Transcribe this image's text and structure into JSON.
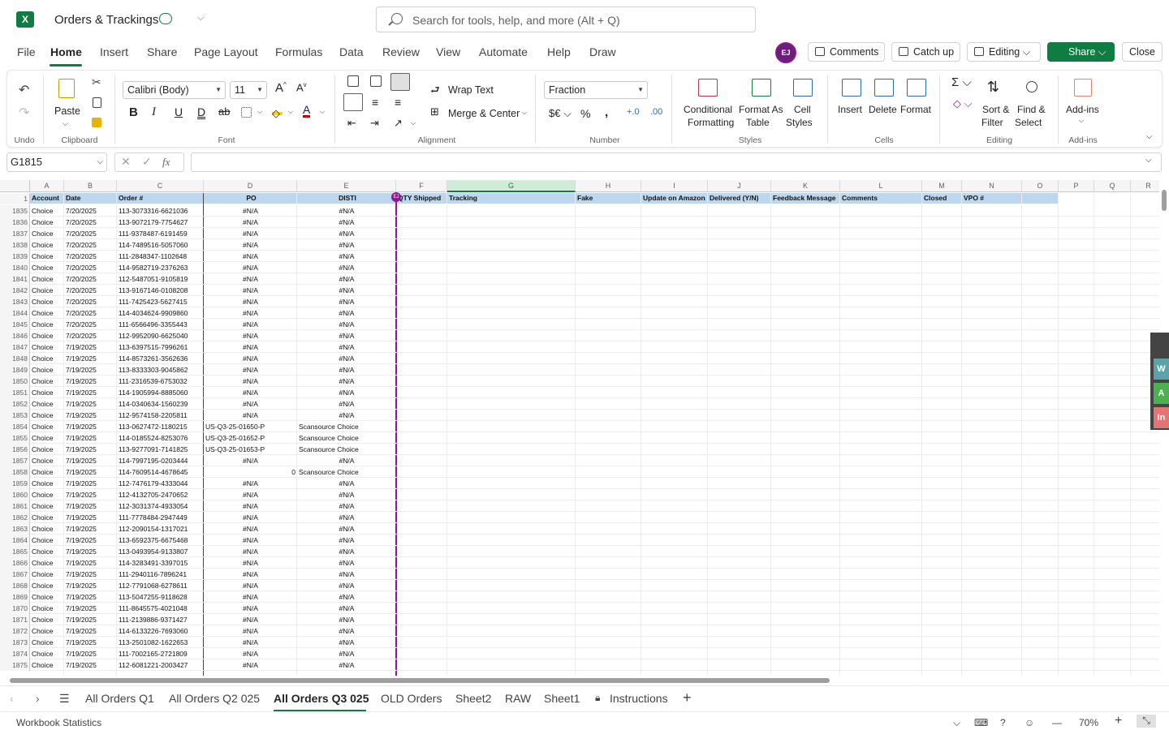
{
  "app": {
    "title": "Orders & Trackings",
    "search_placeholder": "Search for tools, help, and more (Alt + Q)",
    "avatar": "EJ"
  },
  "menu": [
    "File",
    "Home",
    "Insert",
    "Share",
    "Page Layout",
    "Formulas",
    "Data",
    "Review",
    "View",
    "Automate",
    "Help",
    "Draw"
  ],
  "top_buttons": {
    "comments": "Comments",
    "catchup": "Catch up",
    "editing": "Editing",
    "share": "Share",
    "close": "Close"
  },
  "ribbon": {
    "undo_label": "Undo",
    "paste": "Paste",
    "clipboard": "Clipboard",
    "font_name": "Calibri (Body)",
    "font_size": "11",
    "font": "Font",
    "wrap": "Wrap Text",
    "merge": "Merge & Center",
    "alignment": "Alignment",
    "number_format": "Fraction",
    "number": "Number",
    "cond1": "Conditional",
    "cond2": "Formatting",
    "fmt1": "Format As",
    "fmt2": "Table",
    "cs1": "Cell",
    "cs2": "Styles",
    "styles": "Styles",
    "insert": "Insert",
    "delete": "Delete",
    "format": "Format",
    "cells": "Cells",
    "sort1": "Sort &",
    "sort2": "Filter",
    "find1": "Find &",
    "find2": "Select",
    "editing": "Editing",
    "addins": "Add-ins",
    "addins_group": "Add-ins"
  },
  "formula": {
    "namebox": "G1815",
    "fx": "fx",
    "value": ""
  },
  "grid": {
    "columns": [
      "A",
      "B",
      "C",
      "D",
      "E",
      "F",
      "G",
      "H",
      "I",
      "J",
      "K",
      "L",
      "M",
      "N",
      "O",
      "P",
      "Q",
      "R"
    ],
    "headers": [
      "Account",
      "Date",
      "Order #",
      "PO",
      "DISTI",
      "QTY Shipped",
      "Tracking",
      "Fake",
      "Update on Amazon",
      "Delivered (Y/N)",
      "Feedback Message",
      "Comments",
      "Closed",
      "VPO #"
    ],
    "rows": [
      [
        "1835",
        "Choice",
        "7/20/2025",
        "113-3073316-6621036",
        "#N/A",
        "#N/A"
      ],
      [
        "1836",
        "Choice",
        "7/20/2025",
        "113-9072179-7754627",
        "#N/A",
        "#N/A"
      ],
      [
        "1837",
        "Choice",
        "7/20/2025",
        "111-9378487-6191459",
        "#N/A",
        "#N/A"
      ],
      [
        "1838",
        "Choice",
        "7/20/2025",
        "114-7489516-5057060",
        "#N/A",
        "#N/A"
      ],
      [
        "1839",
        "Choice",
        "7/20/2025",
        "111-2848347-1102648",
        "#N/A",
        "#N/A"
      ],
      [
        "1840",
        "Choice",
        "7/20/2025",
        "114-9582719-2376263",
        "#N/A",
        "#N/A"
      ],
      [
        "1841",
        "Choice",
        "7/20/2025",
        "112-5487051-9105819",
        "#N/A",
        "#N/A"
      ],
      [
        "1842",
        "Choice",
        "7/20/2025",
        "113-9167146-0108208",
        "#N/A",
        "#N/A"
      ],
      [
        "1843",
        "Choice",
        "7/20/2025",
        "111-7425423-5627415",
        "#N/A",
        "#N/A"
      ],
      [
        "1844",
        "Choice",
        "7/20/2025",
        "114-4034624-9909860",
        "#N/A",
        "#N/A"
      ],
      [
        "1845",
        "Choice",
        "7/20/2025",
        "111-6566496-3355443",
        "#N/A",
        "#N/A"
      ],
      [
        "1846",
        "Choice",
        "7/20/2025",
        "112-9952090-6625040",
        "#N/A",
        "#N/A"
      ],
      [
        "1847",
        "Choice",
        "7/19/2025",
        "113-6397515-7996261",
        "#N/A",
        "#N/A"
      ],
      [
        "1848",
        "Choice",
        "7/19/2025",
        "114-8573261-3562636",
        "#N/A",
        "#N/A"
      ],
      [
        "1849",
        "Choice",
        "7/19/2025",
        "113-8333303-9045862",
        "#N/A",
        "#N/A"
      ],
      [
        "1850",
        "Choice",
        "7/19/2025",
        "111-2316539-6753032",
        "#N/A",
        "#N/A"
      ],
      [
        "1851",
        "Choice",
        "7/19/2025",
        "114-1905994-8885060",
        "#N/A",
        "#N/A"
      ],
      [
        "1852",
        "Choice",
        "7/19/2025",
        "114-0340634-1560239",
        "#N/A",
        "#N/A"
      ],
      [
        "1853",
        "Choice",
        "7/19/2025",
        "112-9574158-2205811",
        "#N/A",
        "#N/A"
      ],
      [
        "1854",
        "Choice",
        "7/19/2025",
        "113-0627472-1180215",
        "US-Q3-25-01650-P",
        "Scansource Choice"
      ],
      [
        "1855",
        "Choice",
        "7/19/2025",
        "114-0185524-8253076",
        "US-Q3-25-01652-P",
        "Scansource Choice"
      ],
      [
        "1856",
        "Choice",
        "7/19/2025",
        "113-9277091-7141825",
        "US-Q3-25-01653-P",
        "Scansource Choice"
      ],
      [
        "1857",
        "Choice",
        "7/19/2025",
        "114-7997195-0203444",
        "#N/A",
        "#N/A"
      ],
      [
        "1858",
        "Choice",
        "7/19/2025",
        "114-7609514-4678645",
        "0",
        "Scansource Choice"
      ],
      [
        "1859",
        "Choice",
        "7/19/2025",
        "112-7476179-4333044",
        "#N/A",
        "#N/A"
      ],
      [
        "1860",
        "Choice",
        "7/19/2025",
        "112-4132705-2470652",
        "#N/A",
        "#N/A"
      ],
      [
        "1861",
        "Choice",
        "7/19/2025",
        "112-3031374-4933054",
        "#N/A",
        "#N/A"
      ],
      [
        "1862",
        "Choice",
        "7/19/2025",
        "111-7778484-2947449",
        "#N/A",
        "#N/A"
      ],
      [
        "1863",
        "Choice",
        "7/19/2025",
        "112-2090154-1317021",
        "#N/A",
        "#N/A"
      ],
      [
        "1864",
        "Choice",
        "7/19/2025",
        "113-6592375-6675468",
        "#N/A",
        "#N/A"
      ],
      [
        "1865",
        "Choice",
        "7/19/2025",
        "113-0493954-9133807",
        "#N/A",
        "#N/A"
      ],
      [
        "1866",
        "Choice",
        "7/19/2025",
        "114-3283491-3397015",
        "#N/A",
        "#N/A"
      ],
      [
        "1867",
        "Choice",
        "7/19/2025",
        "111-2940116-7896241",
        "#N/A",
        "#N/A"
      ],
      [
        "1868",
        "Choice",
        "7/19/2025",
        "112-7791068-6278611",
        "#N/A",
        "#N/A"
      ],
      [
        "1869",
        "Choice",
        "7/19/2025",
        "113-5047255-9118628",
        "#N/A",
        "#N/A"
      ],
      [
        "1870",
        "Choice",
        "7/19/2025",
        "111-8645575-4021048",
        "#N/A",
        "#N/A"
      ],
      [
        "1871",
        "Choice",
        "7/19/2025",
        "111-2139886-9371427",
        "#N/A",
        "#N/A"
      ],
      [
        "1872",
        "Choice",
        "7/19/2025",
        "114-6133226-7693060",
        "#N/A",
        "#N/A"
      ],
      [
        "1873",
        "Choice",
        "7/19/2025",
        "113-2501082-1622653",
        "#N/A",
        "#N/A"
      ],
      [
        "1874",
        "Choice",
        "7/19/2025",
        "111-7002165-2721809",
        "#N/A",
        "#N/A"
      ],
      [
        "1875",
        "Choice",
        "7/19/2025",
        "112-6081221-2003427",
        "#N/A",
        "#N/A"
      ]
    ]
  },
  "side_panel": [
    "W",
    "A",
    "In"
  ],
  "tabs": [
    "All Orders Q1",
    "All Orders Q2 025",
    "All Orders Q3 025",
    "OLD Orders",
    "Sheet2",
    "RAW",
    "Sheet1",
    "Instructions"
  ],
  "status": {
    "stats": "Workbook Statistics",
    "zoom": "70%"
  }
}
